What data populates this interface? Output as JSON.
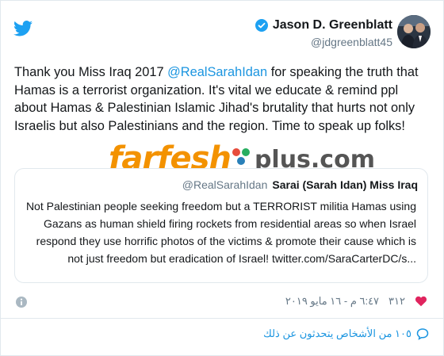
{
  "author": {
    "name": "Jason D. Greenblatt",
    "handle": "@jdgreenblatt45"
  },
  "tweet": {
    "mention": "@RealSarahIdan",
    "text_before": "Thank you Miss Iraq 2017 ",
    "text_after": " for speaking the truth that Hamas is a terrorist organization. It's vital we educate & remind ppl about Hamas & Palestinian Islamic Jihad's brutality that hurts not only Israelis but also Palestinians and the region. Time to speak up folks!"
  },
  "watermark": {
    "main": "farfesh",
    "suffix": "plus.com"
  },
  "quoted_tweet": {
    "name": "Sarai (Sarah Idan) Miss Iraq",
    "handle": "@RealSarahIdan",
    "text": "Not Palestinian people seeking freedom but a TERRORIST militia Hamas using Gazans as human shield firing rockets from residential areas so when Israel respond they use horrific photos of the victims & promote their cause which is not just freedom but eradication of Israel! twitter.com/SaraCarterDC/s..."
  },
  "meta": {
    "likes": "٣١٢",
    "timestamp": "٦:٤٧ م - ١٦ مايو ٢٠١٩"
  },
  "people_talking": "١٠٥ من الأشخاص يتحدثون عن ذلك",
  "colors": {
    "link": "#1b95e0",
    "secondary_text": "#657786",
    "twitter_blue": "#1da1f2",
    "watermark_orange": "#f39200",
    "heart_red": "#e0245e"
  },
  "icons": [
    "twitter-bird-icon",
    "verified-badge-icon",
    "info-icon",
    "heart-icon",
    "speech-bubble-icon"
  ]
}
